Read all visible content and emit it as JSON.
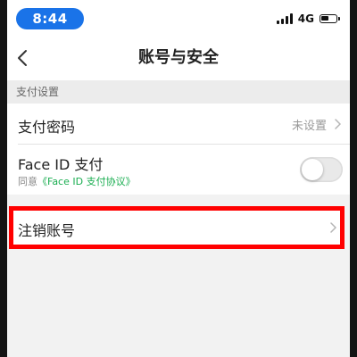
{
  "status_bar": {
    "time": "8:44",
    "network": "4G",
    "icons": [
      "signal-icon",
      "battery-icon"
    ]
  },
  "nav": {
    "title": "账号与安全",
    "back_icon": "chevron-left-icon"
  },
  "section": {
    "header": "支付设置"
  },
  "rows": {
    "pay_password": {
      "label": "支付密码",
      "value": "未设置"
    },
    "face_id": {
      "label": "Face ID 支付",
      "agree_prefix": "同意",
      "agree_link": "《Face ID 支付协议》",
      "enabled": false
    },
    "cancel_account": {
      "label": "注销账号"
    }
  },
  "colors": {
    "accent_blue": "#1a73e8",
    "link_green": "#19ad50",
    "highlight_red": "#ff0000"
  }
}
